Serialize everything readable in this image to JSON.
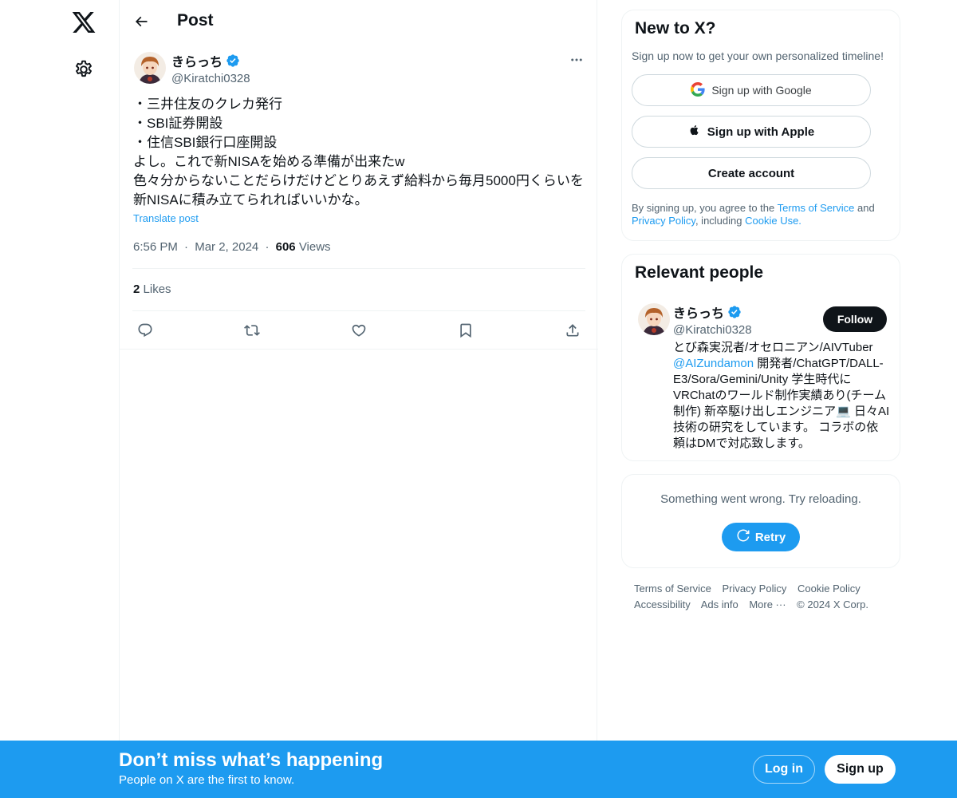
{
  "nav": {
    "logo": "x-logo-icon",
    "settings": "gear-icon"
  },
  "header": {
    "title": "Post"
  },
  "post": {
    "author_name": "きらっち",
    "author_handle": "@Kiratchi0328",
    "lines": [
      "・三井住友のクレカ発行",
      "・SBI証券開設",
      "・住信SBI銀行口座開設",
      "よし。これで新NISAを始める準備が出来たw",
      "色々分からないことだらけだけどとりあえず給料から毎月5000円くらいを",
      "新NISAに積み立てられればいいかな。"
    ],
    "translate": "Translate post",
    "time": "6:56 PM",
    "date": "Mar 2, 2024",
    "views_count": "606",
    "views_label": "Views",
    "likes_count": "2",
    "likes_label": "Likes",
    "sep": "·"
  },
  "signup_card": {
    "title": "New to X?",
    "subtitle": "Sign up now to get your own personalized timeline!",
    "google": "Sign up with Google",
    "apple": "Sign up with Apple",
    "create": "Create account",
    "legal_1": "By signing up, you agree to the ",
    "terms": "Terms of Service",
    "legal_2": " and",
    "privacy": "Privacy Policy",
    "legal_3": ", including ",
    "cookie": "Cookie Use."
  },
  "people_card": {
    "title": "Relevant people",
    "name": "きらっち",
    "handle": "@Kiratchi0328",
    "follow": "Follow",
    "bio_1": "とび森実況者/オセロニアン/AIVTuber",
    "bio_mention": "@AIZundamon",
    "bio_2": " 開発者/ChatGPT/DALL-E3/Sora/Gemini/Unity 学生時代にVRChatのワールド制作実績あり(チーム制作) 新卒駆け出しエンジニア💻 日々AI技術の研究をしています。 コラボの依頼はDMで対応致します。"
  },
  "error_card": {
    "message": "Something went wrong. Try reloading.",
    "retry": "Retry"
  },
  "footer": {
    "links": [
      "Terms of Service",
      "Privacy Policy",
      "Cookie Policy",
      "Accessibility",
      "Ads info",
      "More ···",
      "© 2024 X Corp."
    ]
  },
  "bottom_bar": {
    "title": "Don’t miss what’s happening",
    "subtitle": "People on X are the first to know.",
    "login": "Log in",
    "signup": "Sign up"
  },
  "colors": {
    "accent": "#1d9bf0",
    "text": "#0f1419",
    "muted": "#536471"
  }
}
